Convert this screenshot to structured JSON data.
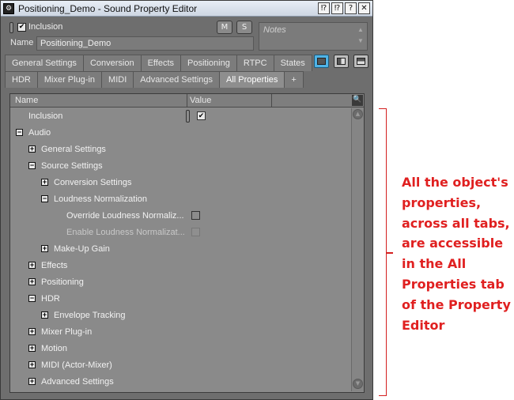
{
  "window": {
    "title": "Positioning_Demo - Sound Property Editor",
    "title_buttons": [
      "⁉",
      "⁉",
      "?",
      "✕"
    ]
  },
  "header": {
    "inclusion_label": "Inclusion",
    "inclusion_checked": true,
    "mute_label": "M",
    "solo_label": "S",
    "name_label": "Name",
    "name_value": "Positioning_Demo",
    "notes_placeholder": "Notes"
  },
  "tabs": {
    "row1": [
      "General Settings",
      "Conversion",
      "Effects",
      "Positioning",
      "RTPC",
      "States"
    ],
    "row2": [
      "HDR",
      "Mixer Plug-in",
      "MIDI",
      "Advanced Settings",
      "All Properties",
      "+"
    ],
    "active": "All Properties"
  },
  "properties": {
    "columns": [
      "Name",
      "Value"
    ],
    "rows": [
      {
        "label": "Inclusion",
        "level": 1,
        "expander": null,
        "value": "checked"
      },
      {
        "label": "Audio",
        "level": 0,
        "expander": "minus",
        "value": null
      },
      {
        "label": "General Settings",
        "level": 1,
        "expander": "plus",
        "value": null
      },
      {
        "label": "Source Settings",
        "level": 1,
        "expander": "minus",
        "value": null
      },
      {
        "label": "Conversion Settings",
        "level": 2,
        "expander": "plus",
        "value": null
      },
      {
        "label": "Loudness Normalization",
        "level": 2,
        "expander": "minus",
        "value": null
      },
      {
        "label": "Override Loudness Normaliz...",
        "level": 3,
        "expander": null,
        "value": "unchecked"
      },
      {
        "label": "Enable Loudness Normalizat...",
        "level": 3,
        "expander": null,
        "value": "disabled"
      },
      {
        "label": "Make-Up Gain",
        "level": 2,
        "expander": "plus",
        "value": null
      },
      {
        "label": "Effects",
        "level": 1,
        "expander": "plus",
        "value": null
      },
      {
        "label": "Positioning",
        "level": 1,
        "expander": "plus",
        "value": null
      },
      {
        "label": "HDR",
        "level": 1,
        "expander": "minus",
        "value": null
      },
      {
        "label": "Envelope Tracking",
        "level": 2,
        "expander": "plus",
        "value": null
      },
      {
        "label": "Mixer Plug-in",
        "level": 1,
        "expander": "plus",
        "value": null
      },
      {
        "label": "Motion",
        "level": 1,
        "expander": "plus",
        "value": null
      },
      {
        "label": "MIDI (Actor-Mixer)",
        "level": 1,
        "expander": "plus",
        "value": null
      },
      {
        "label": "Advanced Settings",
        "level": 1,
        "expander": "plus",
        "value": null
      }
    ]
  },
  "annotation": {
    "text": "All the object's properties, across all tabs, are accessible in the All Properties tab of the Property Editor",
    "color": "#e02020"
  }
}
